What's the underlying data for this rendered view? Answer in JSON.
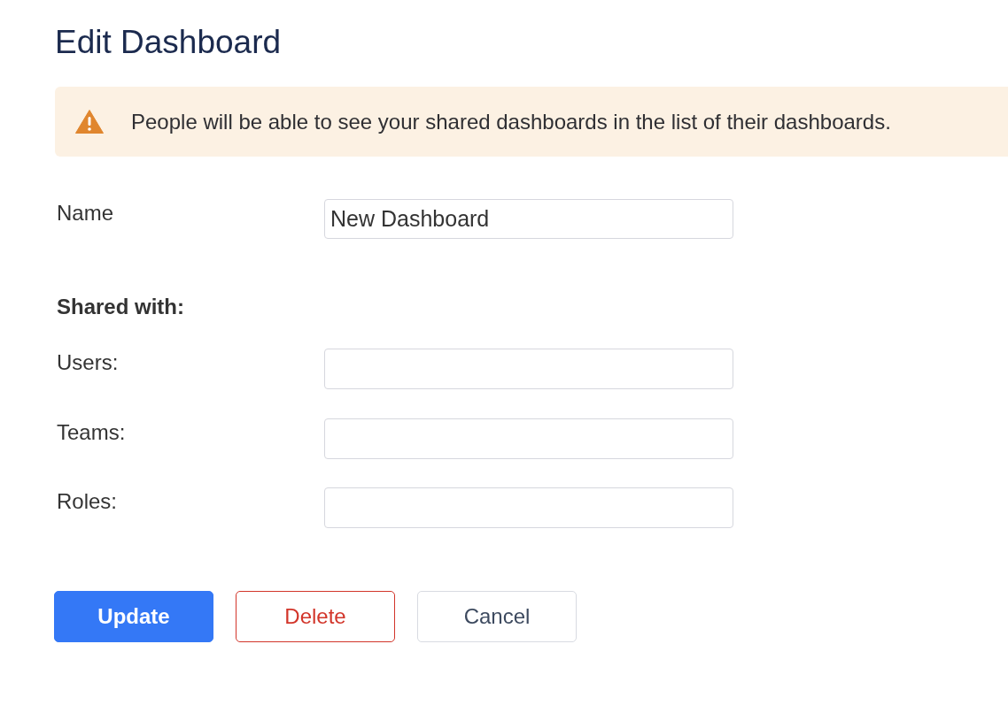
{
  "page": {
    "title": "Edit Dashboard"
  },
  "alert": {
    "kind": "warning",
    "message": "People will be able to see your shared dashboards in the list of their dashboards."
  },
  "name_field": {
    "label": "Name",
    "value": "New Dashboard"
  },
  "shared_with": {
    "heading": "Shared with:",
    "fields": [
      {
        "label": "Users:"
      },
      {
        "label": "Teams:"
      },
      {
        "label": "Roles:"
      }
    ]
  },
  "buttons": [
    {
      "label": "Update",
      "kind": "primary"
    },
    {
      "label": "Delete",
      "kind": "danger"
    },
    {
      "label": "Cancel",
      "kind": "secondary"
    }
  ]
}
